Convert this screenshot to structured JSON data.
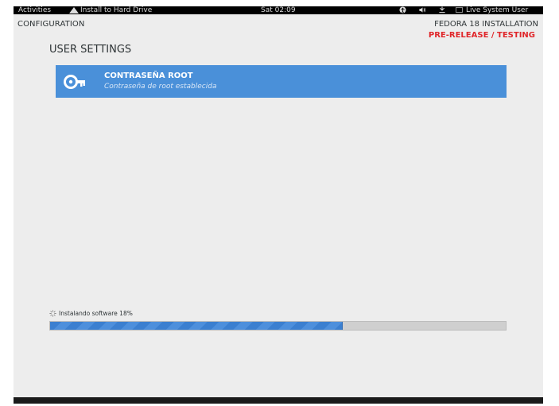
{
  "topbar": {
    "activities": "Activities",
    "app_name": "Install to Hard Drive",
    "clock": "Sat 02:09",
    "user": "Live System User",
    "icons": [
      "accessibility-icon",
      "volume-icon",
      "network-icon",
      "user-status-icon"
    ]
  },
  "header": {
    "section": "CONFIGURATION",
    "product": "FEDORA 18 INSTALLATION",
    "prerelease": "PRE-RELEASE / TESTING",
    "prerelease_color": "#e0262a"
  },
  "user_settings": {
    "title": "USER SETTINGS",
    "spokes": [
      {
        "title": "CONTRASEÑA ROOT",
        "status": "Contraseña de root establecida",
        "icon": "key-icon"
      }
    ]
  },
  "progress": {
    "label": "Instalando software 18%",
    "fraction": 0.64,
    "color": "#3b7fd0"
  }
}
